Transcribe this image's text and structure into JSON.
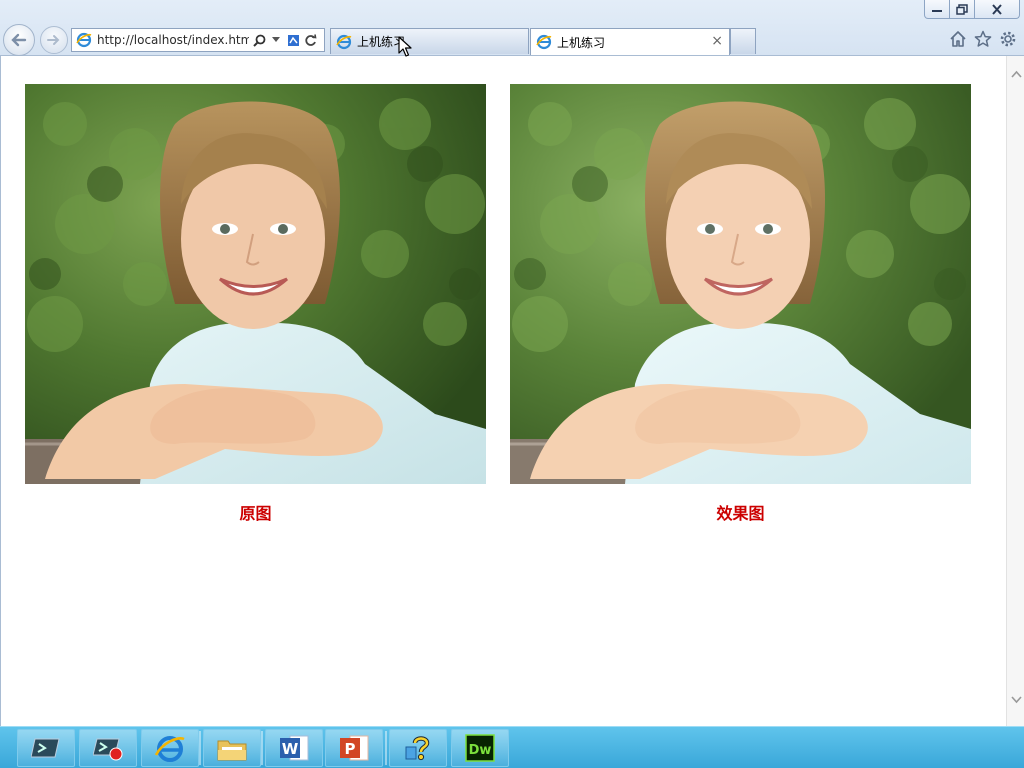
{
  "browser": {
    "url": "http://localhost/index.htm",
    "tabs": [
      {
        "label": "上机练习"
      },
      {
        "label": "上机练习"
      }
    ],
    "tab_close_glyph": "×"
  },
  "content": {
    "images": [
      {
        "caption": "原图"
      },
      {
        "caption": "效果图"
      }
    ],
    "caption_color": "#cc0000"
  },
  "taskbar": {
    "apps": [
      "powershell-icon",
      "recorder-icon",
      "internet-explorer-icon",
      "file-explorer-icon",
      "word-icon",
      "powerpoint-icon",
      "help-icon",
      "dreamweaver-icon"
    ],
    "dreamweaver_label": "Dw",
    "word_label": "W",
    "powerpoint_label": "P"
  }
}
